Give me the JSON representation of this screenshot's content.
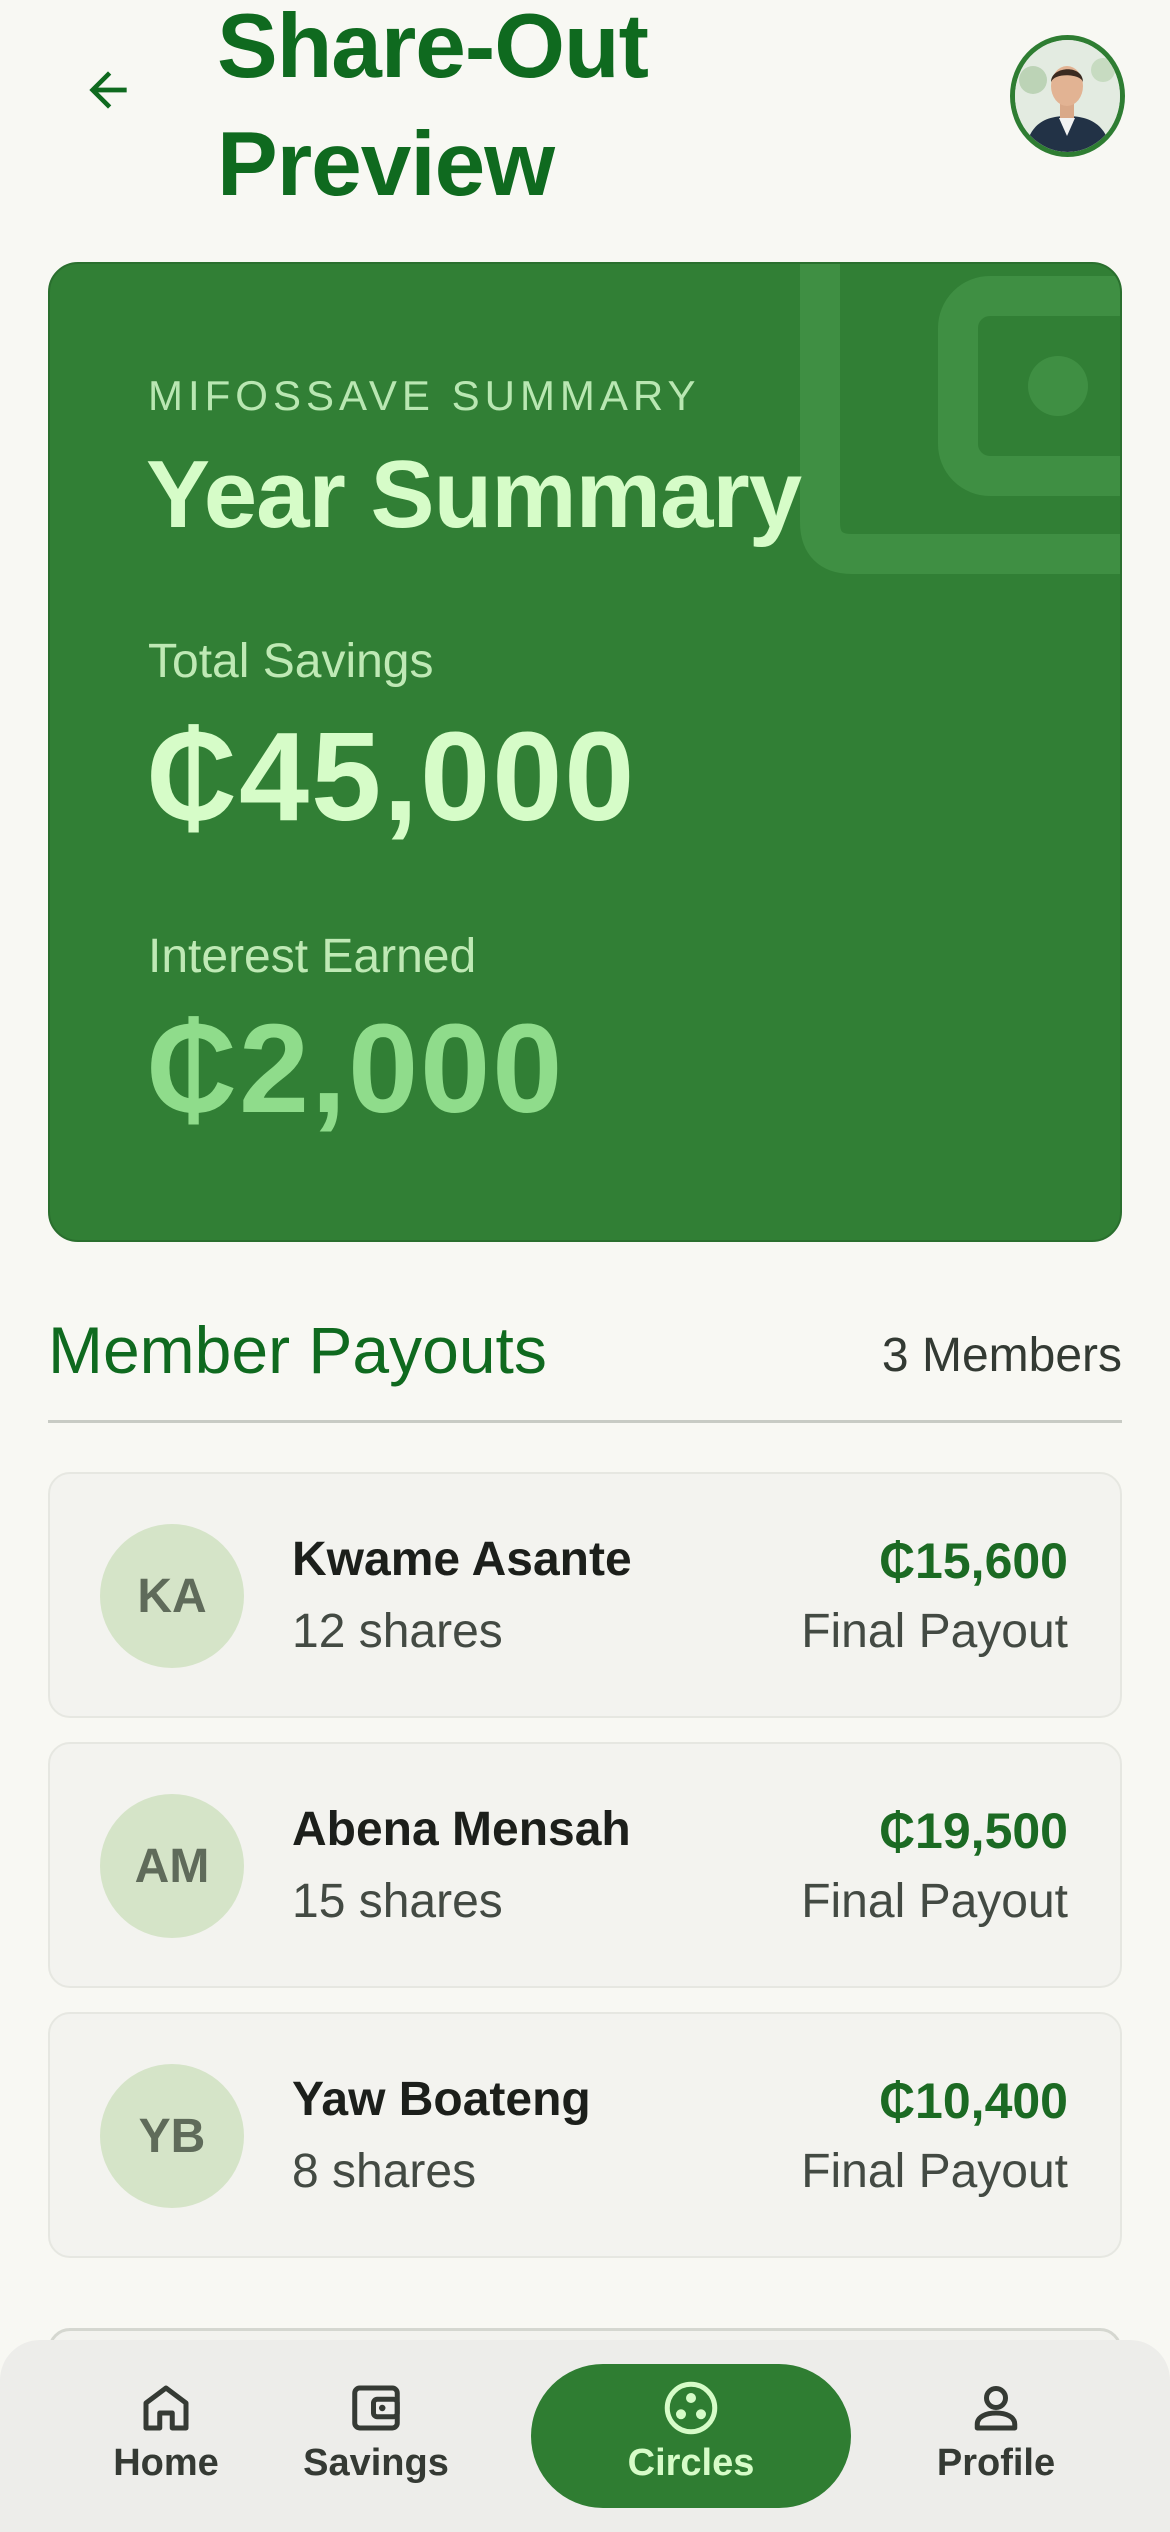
{
  "header": {
    "title": "Share-Out Preview",
    "back_icon": "arrow-left-icon",
    "avatar_icon": "profile-photo"
  },
  "summary": {
    "kicker": "MIFOSSAVE SUMMARY",
    "heading": "Year Summary",
    "total_savings_label": "Total Savings",
    "total_savings_value": "₵45,000",
    "interest_label": "Interest Earned",
    "interest_value": "₵2,000"
  },
  "payouts": {
    "title": "Member Payouts",
    "count_label": "3 Members",
    "members": [
      {
        "initials": "KA",
        "name": "Kwame Asante",
        "shares": "12 shares",
        "amount": "₵15,600",
        "payout_label": "Final Payout"
      },
      {
        "initials": "AM",
        "name": "Abena Mensah",
        "shares": "15 shares",
        "amount": "₵19,500",
        "payout_label": "Final Payout"
      },
      {
        "initials": "YB",
        "name": "Yaw Boateng",
        "shares": "8 shares",
        "amount": "₵10,400",
        "payout_label": "Final Payout"
      }
    ]
  },
  "nav": {
    "items": [
      {
        "label": "Home",
        "icon": "home-icon"
      },
      {
        "label": "Savings",
        "icon": "wallet-icon"
      },
      {
        "label": "Circles",
        "icon": "circles-icon",
        "active": true
      },
      {
        "label": "Profile",
        "icon": "person-icon"
      }
    ]
  },
  "colors": {
    "brand_green": "#2f7d32",
    "title_green": "#0f6a1f",
    "background": "#f8f8f3"
  }
}
